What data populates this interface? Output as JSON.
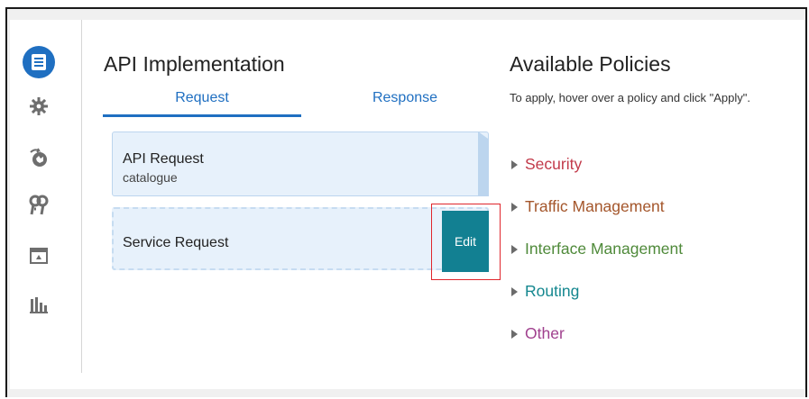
{
  "colors": {
    "accent": "#1f6fc1",
    "edit_button": "#128092",
    "highlight_box": "#e0262c",
    "security": "#c23a4a",
    "traffic": "#a4562b",
    "interface": "#4f8a3a",
    "routing": "#14878f",
    "other": "#a0408e"
  },
  "sidebar": {
    "items": [
      {
        "icon": "api-implementation-icon",
        "active": true
      },
      {
        "icon": "gear-icon",
        "active": false
      },
      {
        "icon": "deployments-icon",
        "active": false
      },
      {
        "icon": "keys-icon",
        "active": false
      },
      {
        "icon": "portal-icon",
        "active": false
      },
      {
        "icon": "analytics-chart-icon",
        "active": false
      }
    ]
  },
  "implementation": {
    "title": "API Implementation",
    "tabs": [
      {
        "label": "Request",
        "active": true
      },
      {
        "label": "Response",
        "active": false
      }
    ],
    "api_request": {
      "title": "API Request",
      "subtitle": "catalogue"
    },
    "service_request": {
      "title": "Service Request",
      "edit_label": "Edit"
    }
  },
  "policies": {
    "title": "Available Policies",
    "hint": "To apply, hover over a policy and click \"Apply\".",
    "items": [
      {
        "label": "Security"
      },
      {
        "label": "Traffic Management"
      },
      {
        "label": "Interface Management"
      },
      {
        "label": "Routing"
      },
      {
        "label": "Other"
      }
    ]
  }
}
